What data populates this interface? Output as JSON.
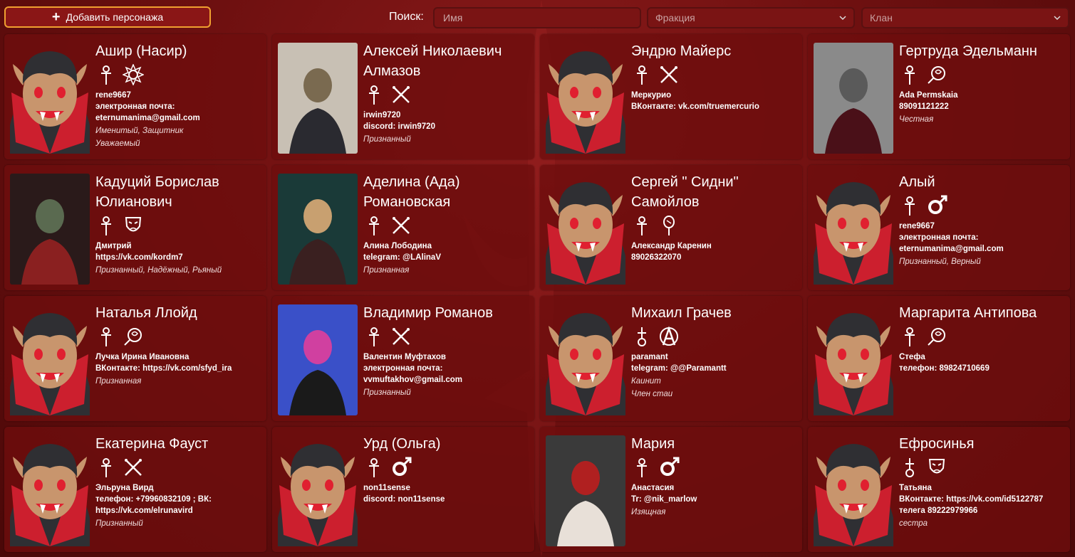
{
  "toolbar": {
    "add_label": "Добавить персонажа",
    "search_label": "Поиск:",
    "name_placeholder": "Имя",
    "faction_placeholder": "Фракция",
    "clan_placeholder": "Клан"
  },
  "colors": {
    "accent": "#f0a030",
    "card": "#6e0e0e",
    "background": "#6e1010"
  },
  "characters": [
    {
      "name": "Ашир (Насир)",
      "icons": [
        "ankh-icon",
        "sun-emblem-icon"
      ],
      "contact": [
        "rene9667",
        "электронная почта:",
        "eternumanima@gmail.com"
      ],
      "status": [
        "Именитый, Защитник",
        "Уважаемый"
      ],
      "avatar": "vampire"
    },
    {
      "name": "Алексей Николаевич Алмазов",
      "icons": [
        "ankh-icon",
        "crossed-swords-icon"
      ],
      "contact": [
        "irwin9720",
        "discord: irwin9720"
      ],
      "status": [
        "Признанный"
      ],
      "avatar": "photo"
    },
    {
      "name": "Эндрю Майерс",
      "icons": [
        "ankh-icon",
        "crossed-swords-icon"
      ],
      "contact": [
        "Меркурио",
        "ВКонтакте: vk.com/truemercurio"
      ],
      "status": [],
      "avatar": "vampire"
    },
    {
      "name": "Гертруда Эдельманн",
      "icons": [
        "ankh-icon",
        "rose-icon"
      ],
      "contact": [
        "Ada Permskaia",
        "89091121222"
      ],
      "status": [
        "Честная"
      ],
      "avatar": "photo"
    },
    {
      "name": "Кадуций Борислав Юлианович",
      "icons": [
        "ankh-icon",
        "mask-icon"
      ],
      "contact": [
        "Дмитрий",
        "https://vk.com/kordm7"
      ],
      "status": [
        "Признанный, Надёжный, Рьяный"
      ],
      "avatar": "photo"
    },
    {
      "name": "Аделина (Ада) Романовская",
      "icons": [
        "ankh-icon",
        "crossed-swords-icon"
      ],
      "contact": [
        "Алина Лободина",
        "telegram: @LAlinaV"
      ],
      "status": [
        "Признанная"
      ],
      "avatar": "photo"
    },
    {
      "name": "Сергей \" Сидни\" Самойлов",
      "icons": [
        "ankh-icon",
        "mirror-icon"
      ],
      "contact": [
        "Александр Каренин",
        "89026322070"
      ],
      "status": [],
      "avatar": "vampire"
    },
    {
      "name": "Алый",
      "icons": [
        "ankh-icon",
        "mars-icon"
      ],
      "contact": [
        "rene9667",
        "электронная почта:",
        "eternumanima@gmail.com"
      ],
      "status": [
        "Признанный, Верный"
      ],
      "avatar": "vampire"
    },
    {
      "name": "Наталья Ллойд",
      "icons": [
        "ankh-icon",
        "rose-icon"
      ],
      "contact": [
        "Лучка Ирина Ивановна",
        "ВКонтакте: https://vk.com/sfyd_ira"
      ],
      "status": [
        "Признанная"
      ],
      "avatar": "vampire"
    },
    {
      "name": "Владимир Романов",
      "icons": [
        "ankh-icon",
        "crossed-swords-icon"
      ],
      "contact": [
        "Валентин Муфтахов",
        "электронная почта:",
        "vvmuftakhov@gmail.com"
      ],
      "status": [
        "Признанный"
      ],
      "avatar": "photo"
    },
    {
      "name": "Михаил Грачев",
      "icons": [
        "anarch-cross-icon",
        "anarch-a-icon"
      ],
      "contact": [
        "paramant",
        "telegram: @@Paramantt"
      ],
      "status": [
        "Каинит",
        "Член стаи"
      ],
      "avatar": "vampire"
    },
    {
      "name": "Маргарита Антипова",
      "icons": [
        "ankh-icon",
        "rose-icon"
      ],
      "contact": [
        "Стефа",
        "телефон: 89824710669"
      ],
      "status": [],
      "avatar": "vampire"
    },
    {
      "name": "Екатерина Фауст",
      "icons": [
        "ankh-icon",
        "crossed-swords-icon"
      ],
      "contact": [
        "Эльруна Вирд",
        "телефон: +79960832109 ; ВК:",
        "https://vk.com/elrunavird"
      ],
      "status": [
        "Признанный"
      ],
      "avatar": "vampire"
    },
    {
      "name": "Урд (Ольга)",
      "icons": [
        "ankh-icon",
        "mars-icon"
      ],
      "contact": [
        "non11sense",
        "discord: non11sense"
      ],
      "status": [],
      "avatar": "vampire"
    },
    {
      "name": "Мария",
      "icons": [
        "ankh-icon",
        "mars-icon"
      ],
      "contact": [
        "Анастасия",
        "Tr: @nik_marlow"
      ],
      "status": [
        "Изящная"
      ],
      "avatar": "photo"
    },
    {
      "name": "Ефросинья",
      "icons": [
        "anarch-cross-icon",
        "mask-icon"
      ],
      "contact": [
        "Татьяна",
        "ВКонтакте: https://vk.com/id5122787",
        "телега 89222979966"
      ],
      "status": [
        "сестра"
      ],
      "avatar": "vampire"
    }
  ]
}
